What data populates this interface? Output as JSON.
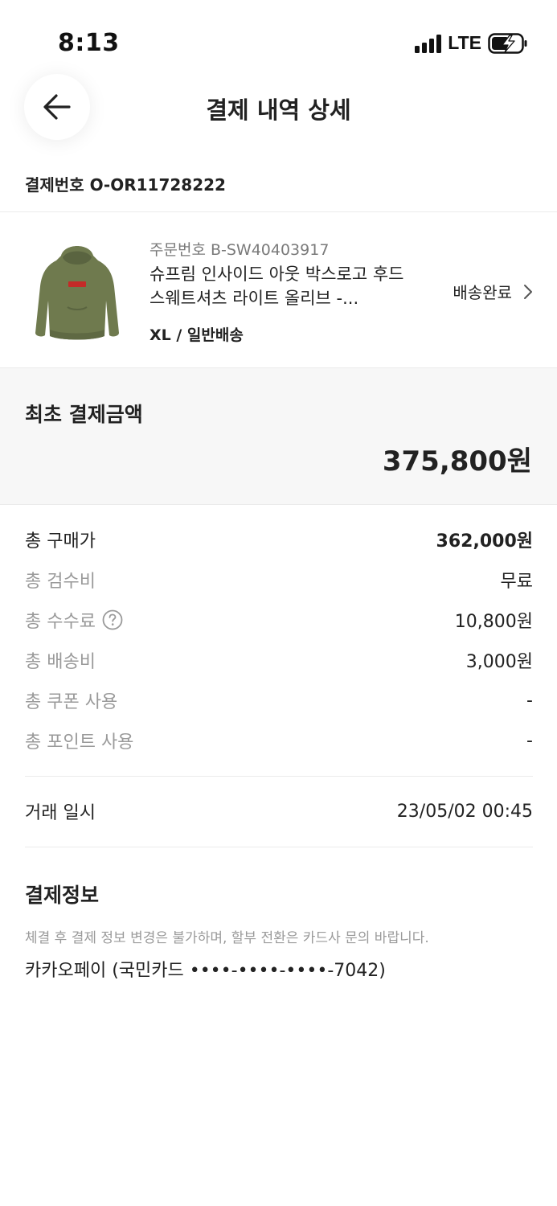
{
  "status": {
    "time": "8:13",
    "network": "LTE"
  },
  "header": {
    "title": "결제 내역 상세",
    "back_icon": "arrow-left-icon"
  },
  "payment_number": "결제번호 O-OR11728222",
  "product": {
    "order_number": "주문번호 B-SW40403917",
    "name": "슈프림 인사이드 아웃 박스로고 후드 스웨트셔츠 라이트 올리브 -...",
    "option": "XL / 일반배송",
    "status": "배송완료",
    "thumbnail_color": "#6f7a4e"
  },
  "initial_payment": {
    "label": "최초 결제금액",
    "amount": "375,800원"
  },
  "breakdown": [
    {
      "label": "총 구매가",
      "value": "362,000원"
    },
    {
      "label": "총 검수비",
      "value": "무료"
    },
    {
      "label": "총 수수료",
      "value": "10,800원"
    },
    {
      "label": "총 배송비",
      "value": "3,000원"
    },
    {
      "label": "총 쿠폰 사용",
      "value": "-"
    },
    {
      "label": "총 포인트 사용",
      "value": "-"
    }
  ],
  "transaction": {
    "label": "거래 일시",
    "value": "23/05/02 00:45"
  },
  "payment_info": {
    "title": "결제정보",
    "notice": "체결 후 결제 정보 변경은 불가하며, 할부 전환은 카드사 문의 바랍니다.",
    "method": "카카오페이 (국민카드 ••••-••••-••••-7042)"
  }
}
